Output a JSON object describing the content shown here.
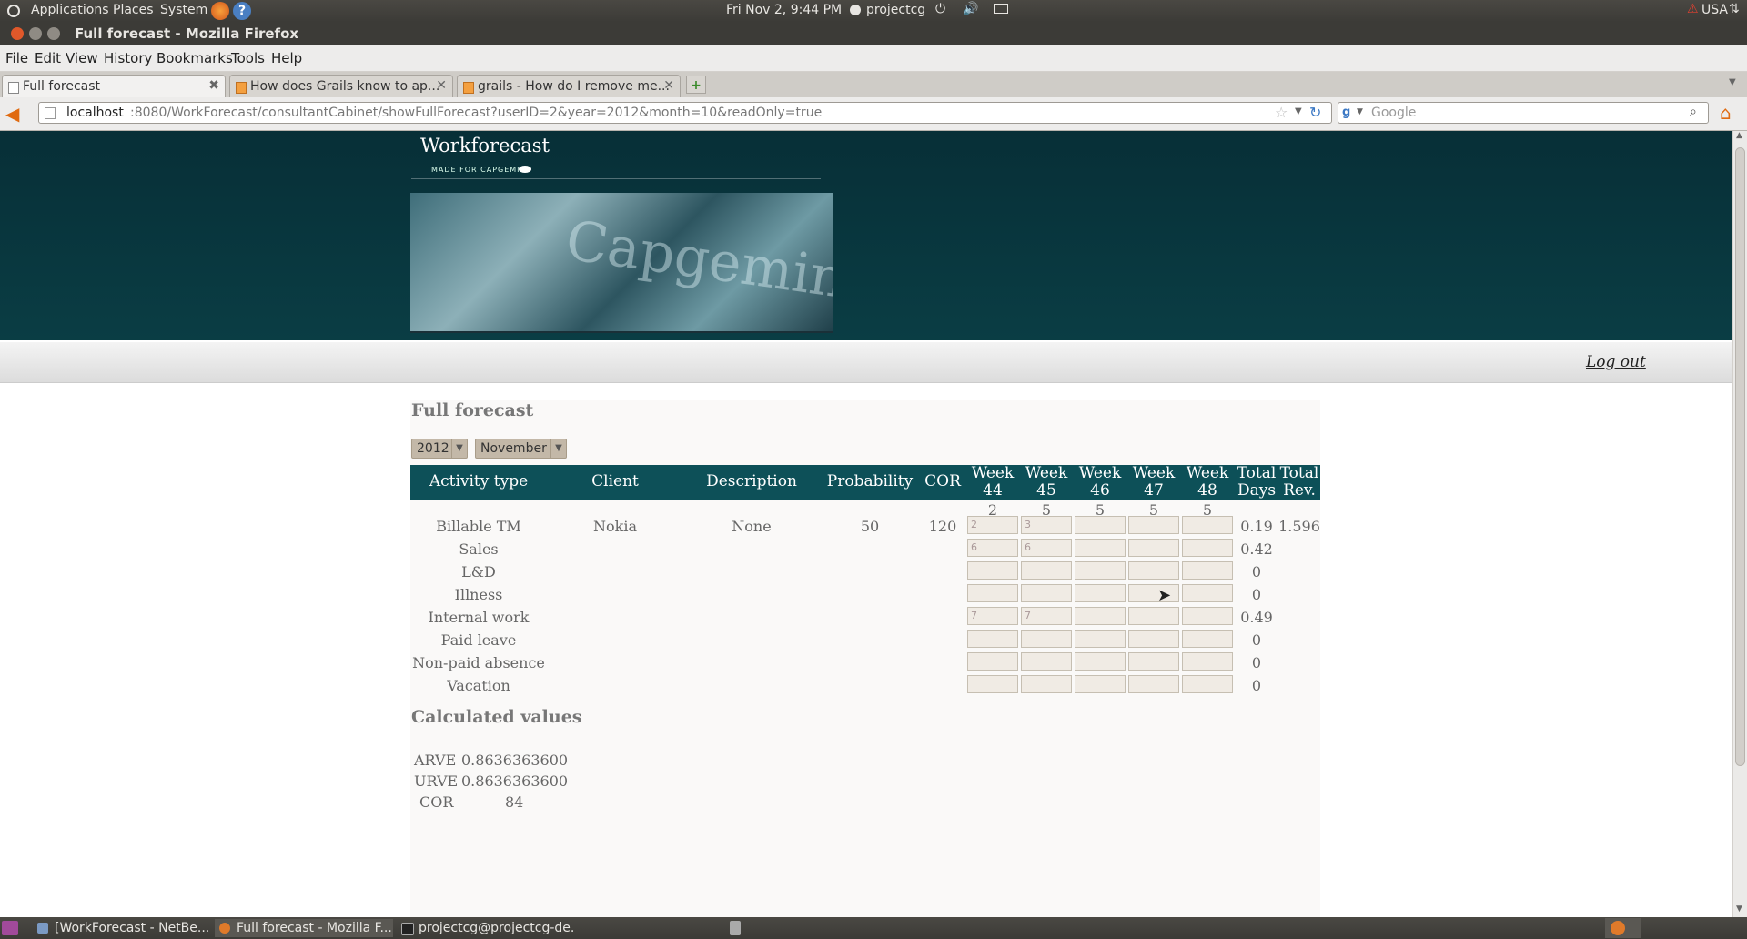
{
  "top_panel": {
    "menus": [
      "Applications",
      "Places",
      "System"
    ],
    "clock": "Fri Nov  2,  9:44 PM",
    "user": "projectcg",
    "keyboard": "USA"
  },
  "window": {
    "title": "Full forecast - Mozilla Firefox"
  },
  "menubar": [
    "File",
    "Edit",
    "View",
    "History",
    "Bookmarks",
    "Tools",
    "Help"
  ],
  "tabs": [
    {
      "label": "Full forecast",
      "active": true
    },
    {
      "label": "How does Grails know to ap...",
      "active": false
    },
    {
      "label": "grails - How do I remove me...",
      "active": false
    }
  ],
  "urlbar": {
    "host": "localhost",
    "path": ":8080/WorkForecast/consultantCabinet/showFullForecast?userID=2&year=2012&month=10&readOnly=true"
  },
  "search": {
    "engine_icon": "google-icon",
    "placeholder": "Google"
  },
  "site": {
    "logo": "Workforecast",
    "logo_sub": "MADE FOR CAPGEMINI",
    "banner_word": "Capgemini",
    "logout": "Log out"
  },
  "forecast": {
    "title": "Full forecast",
    "year": "2012",
    "month": "November",
    "columns": {
      "activity_type": "Activity type",
      "client": "Client",
      "description": "Description",
      "probability": "Probability",
      "cor": "COR",
      "week": "Week",
      "total": "Total",
      "days": "Days",
      "rev": "Rev."
    },
    "weeks": [
      "44",
      "45",
      "46",
      "47",
      "48"
    ],
    "week_days": [
      "2",
      "5",
      "5",
      "5",
      "5"
    ],
    "rows": [
      {
        "activity": "Billable TM",
        "client": "Nokia",
        "description": "None",
        "probability": "50",
        "cor": "120",
        "weeks": [
          "2",
          "3",
          "",
          "",
          ""
        ],
        "total_days": "0.19",
        "total_rev": "1.596"
      },
      {
        "activity": "Sales",
        "client": "",
        "description": "",
        "probability": "",
        "cor": "",
        "weeks": [
          "6",
          "6",
          "",
          "",
          ""
        ],
        "total_days": "0.42",
        "total_rev": ""
      },
      {
        "activity": "L&D",
        "client": "",
        "description": "",
        "probability": "",
        "cor": "",
        "weeks": [
          "",
          "",
          "",
          "",
          ""
        ],
        "total_days": "0",
        "total_rev": ""
      },
      {
        "activity": "Illness",
        "client": "",
        "description": "",
        "probability": "",
        "cor": "",
        "weeks": [
          "",
          "",
          "",
          "",
          ""
        ],
        "total_days": "0",
        "total_rev": ""
      },
      {
        "activity": "Internal work",
        "client": "",
        "description": "",
        "probability": "",
        "cor": "",
        "weeks": [
          "7",
          "7",
          "",
          "",
          ""
        ],
        "total_days": "0.49",
        "total_rev": ""
      },
      {
        "activity": "Paid leave",
        "client": "",
        "description": "",
        "probability": "",
        "cor": "",
        "weeks": [
          "",
          "",
          "",
          "",
          ""
        ],
        "total_days": "0",
        "total_rev": ""
      },
      {
        "activity": "Non-paid absence",
        "client": "",
        "description": "",
        "probability": "",
        "cor": "",
        "weeks": [
          "",
          "",
          "",
          "",
          ""
        ],
        "total_days": "0",
        "total_rev": ""
      },
      {
        "activity": "Vacation",
        "client": "",
        "description": "",
        "probability": "",
        "cor": "",
        "weeks": [
          "",
          "",
          "",
          "",
          ""
        ],
        "total_days": "0",
        "total_rev": ""
      }
    ]
  },
  "calculated": {
    "title": "Calculated values",
    "arve_label": "ARVE",
    "arve": "0.8636363600",
    "urve_label": "URVE",
    "urve": "0.8636363600",
    "cor_label": "COR",
    "cor": "84"
  },
  "taskbar": [
    {
      "label": "[WorkForecast - NetBe...",
      "active": false
    },
    {
      "label": "Full forecast - Mozilla F...",
      "active": true
    },
    {
      "label": "projectcg@projectcg-de...",
      "active": false
    }
  ],
  "colors": {
    "header_bg": "#0a3d44",
    "table_header": "#0d5058",
    "select_bg": "#c3b8a8",
    "panel_bg": "#3c3b37"
  }
}
